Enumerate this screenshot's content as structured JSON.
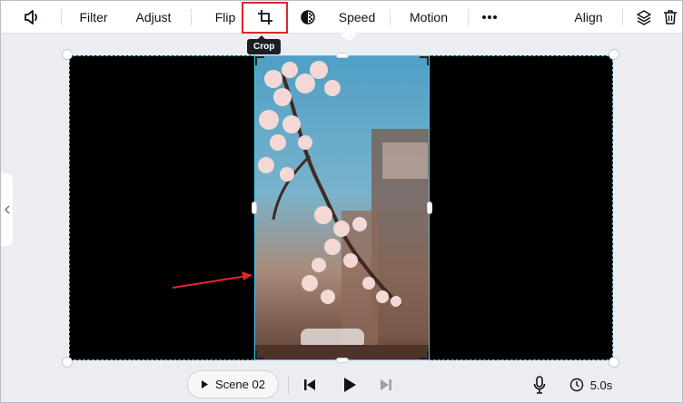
{
  "toolbar": {
    "filter_label": "Filter",
    "adjust_label": "Adjust",
    "flip_label": "Flip",
    "crop_tooltip": "Crop",
    "speed_label": "Speed",
    "motion_label": "Motion",
    "align_label": "Align",
    "icons": [
      "volume-icon",
      "crop-icon",
      "transparency-icon",
      "more-icon",
      "layers-icon",
      "trash-icon"
    ]
  },
  "playback": {
    "scene_label": "Scene 02",
    "duration": "5.0s",
    "icons": [
      "play-icon",
      "skip-back-icon",
      "skip-forward-icon",
      "microphone-icon",
      "clock-icon"
    ]
  },
  "colors": {
    "highlight": "#e0262a",
    "selection": "#44c8e8",
    "arrow": "#e0262a"
  }
}
